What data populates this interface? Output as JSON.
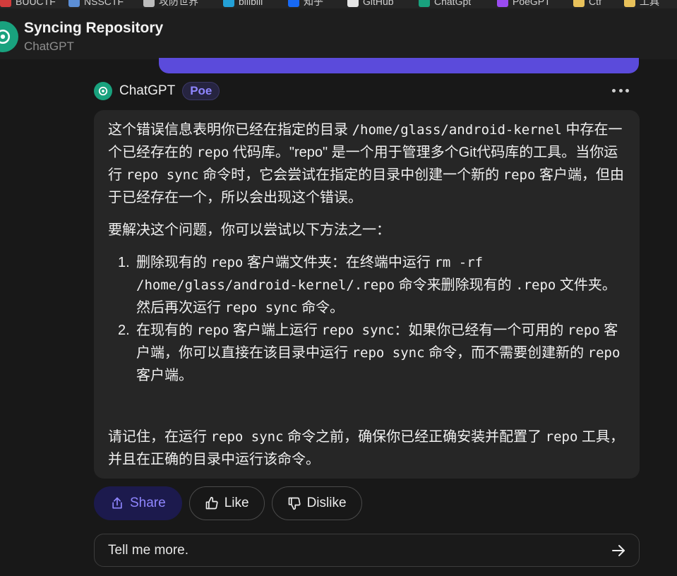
{
  "bookmarks": [
    {
      "label": "BUUCTF",
      "icon": "bookmark-red-icon",
      "color": "#d23c3c"
    },
    {
      "label": "NSSCTF",
      "icon": "nssctf-icon",
      "color": "#5c8fd6"
    },
    {
      "label": "攻防世界",
      "icon": "globe-icon",
      "color": "#bdbdbd"
    },
    {
      "label": "bilibili",
      "icon": "bilibili-icon",
      "color": "#23a0d6"
    },
    {
      "label": "知乎",
      "icon": "zhihu-icon",
      "color": "#1769f5"
    },
    {
      "label": "GitHub",
      "icon": "github-icon",
      "color": "#e6e6e6"
    },
    {
      "label": "ChatGpt",
      "icon": "chatgpt-icon",
      "color": "#19a27e"
    },
    {
      "label": "PoeGPT",
      "icon": "poe-icon",
      "color": "#9a4bf0"
    },
    {
      "label": "Ctf",
      "icon": "folder-icon",
      "color": "#e8c15a"
    },
    {
      "label": "工具",
      "icon": "folder-icon",
      "color": "#e8c15a"
    }
  ],
  "header": {
    "title": "Syncing Repository",
    "subtitle": "ChatGPT"
  },
  "message": {
    "bot_name": "ChatGPT",
    "badge": "Poe",
    "p1": [
      {
        "t": "text",
        "v": "这个错误信息表明你已经在指定的目录 "
      },
      {
        "t": "code",
        "v": "/home/glass/android-kernel"
      },
      {
        "t": "text",
        "v": " 中存在一个已经存在的 "
      },
      {
        "t": "code",
        "v": "repo"
      },
      {
        "t": "text",
        "v": " 代码库。\"repo\" 是一个用于管理多个Git代码库的工具。当你运行 "
      },
      {
        "t": "code",
        "v": "repo sync"
      },
      {
        "t": "text",
        "v": " 命令时，它会尝试在指定的目录中创建一个新的 "
      },
      {
        "t": "code",
        "v": "repo"
      },
      {
        "t": "text",
        "v": " 客户端，但由于已经存在一个，所以会出现这个错误。"
      }
    ],
    "p2": "要解决这个问题，你可以尝试以下方法之一：",
    "list": [
      {
        "num": "1.",
        "parts": [
          {
            "t": "text",
            "v": "删除现有的 "
          },
          {
            "t": "code",
            "v": "repo"
          },
          {
            "t": "text",
            "v": " 客户端文件夹：在终端中运行 "
          },
          {
            "t": "code",
            "v": "rm -rf /home/glass/android-kernel/.repo"
          },
          {
            "t": "text",
            "v": " 命令来删除现有的 "
          },
          {
            "t": "code",
            "v": ".repo"
          },
          {
            "t": "text",
            "v": " 文件夹。然后再次运行 "
          },
          {
            "t": "code",
            "v": "repo sync"
          },
          {
            "t": "text",
            "v": " 命令。"
          }
        ]
      },
      {
        "num": "2.",
        "parts": [
          {
            "t": "text",
            "v": "在现有的 "
          },
          {
            "t": "code",
            "v": "repo"
          },
          {
            "t": "text",
            "v": " 客户端上运行 "
          },
          {
            "t": "code",
            "v": "repo sync"
          },
          {
            "t": "text",
            "v": "：如果你已经有一个可用的 "
          },
          {
            "t": "code",
            "v": "repo"
          },
          {
            "t": "text",
            "v": " 客户端，你可以直接在该目录中运行 "
          },
          {
            "t": "code",
            "v": "repo sync"
          },
          {
            "t": "text",
            "v": " 命令，而不需要创建新的 "
          },
          {
            "t": "code",
            "v": "repo"
          },
          {
            "t": "text",
            "v": " 客户端。"
          }
        ]
      }
    ],
    "p3": [
      {
        "t": "text",
        "v": "请记住，在运行 "
      },
      {
        "t": "code",
        "v": "repo sync"
      },
      {
        "t": "text",
        "v": " 命令之前，确保你已经正确安装并配置了 "
      },
      {
        "t": "code",
        "v": "repo"
      },
      {
        "t": "text",
        "v": " 工具，并且在正确的目录中运行该命令。"
      }
    ]
  },
  "actions": {
    "share_label": "Share",
    "like_label": "Like",
    "dislike_label": "Dislike"
  },
  "composer": {
    "value": "Tell me more.",
    "placeholder": "Tell me more."
  }
}
